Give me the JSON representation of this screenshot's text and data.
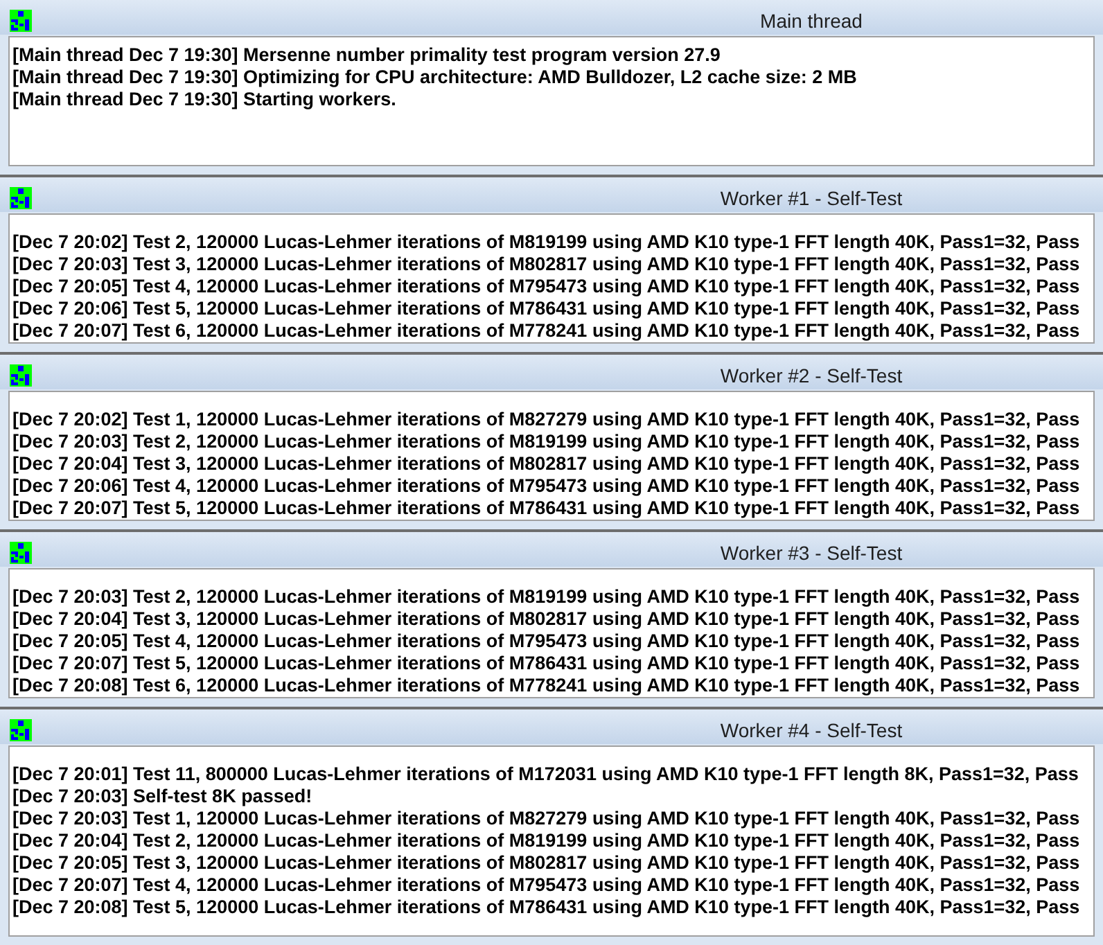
{
  "windows": [
    {
      "title": "Main thread",
      "lines": [
        "[Main thread Dec 7 19:30] Mersenne number primality test program version 27.9",
        "[Main thread Dec 7 19:30] Optimizing for CPU architecture: AMD Bulldozer, L2 cache size: 2 MB",
        "[Main thread Dec 7 19:30] Starting workers."
      ]
    },
    {
      "title": "Worker #1 - Self-Test",
      "lines": [
        "[Dec 7 20:02] Test 2, 120000 Lucas-Lehmer iterations of M819199 using AMD K10 type-1 FFT length 40K, Pass1=32, Pass",
        "[Dec 7 20:03] Test 3, 120000 Lucas-Lehmer iterations of M802817 using AMD K10 type-1 FFT length 40K, Pass1=32, Pass",
        "[Dec 7 20:05] Test 4, 120000 Lucas-Lehmer iterations of M795473 using AMD K10 type-1 FFT length 40K, Pass1=32, Pass",
        "[Dec 7 20:06] Test 5, 120000 Lucas-Lehmer iterations of M786431 using AMD K10 type-1 FFT length 40K, Pass1=32, Pass",
        "[Dec 7 20:07] Test 6, 120000 Lucas-Lehmer iterations of M778241 using AMD K10 type-1 FFT length 40K, Pass1=32, Pass"
      ]
    },
    {
      "title": "Worker #2 - Self-Test",
      "lines": [
        "[Dec 7 20:02] Test 1, 120000 Lucas-Lehmer iterations of M827279 using AMD K10 type-1 FFT length 40K, Pass1=32, Pass",
        "[Dec 7 20:03] Test 2, 120000 Lucas-Lehmer iterations of M819199 using AMD K10 type-1 FFT length 40K, Pass1=32, Pass",
        "[Dec 7 20:04] Test 3, 120000 Lucas-Lehmer iterations of M802817 using AMD K10 type-1 FFT length 40K, Pass1=32, Pass",
        "[Dec 7 20:06] Test 4, 120000 Lucas-Lehmer iterations of M795473 using AMD K10 type-1 FFT length 40K, Pass1=32, Pass",
        "[Dec 7 20:07] Test 5, 120000 Lucas-Lehmer iterations of M786431 using AMD K10 type-1 FFT length 40K, Pass1=32, Pass"
      ]
    },
    {
      "title": "Worker #3 - Self-Test",
      "lines": [
        "[Dec 7 20:03] Test 2, 120000 Lucas-Lehmer iterations of M819199 using AMD K10 type-1 FFT length 40K, Pass1=32, Pass",
        "[Dec 7 20:04] Test 3, 120000 Lucas-Lehmer iterations of M802817 using AMD K10 type-1 FFT length 40K, Pass1=32, Pass",
        "[Dec 7 20:05] Test 4, 120000 Lucas-Lehmer iterations of M795473 using AMD K10 type-1 FFT length 40K, Pass1=32, Pass",
        "[Dec 7 20:07] Test 5, 120000 Lucas-Lehmer iterations of M786431 using AMD K10 type-1 FFT length 40K, Pass1=32, Pass",
        "[Dec 7 20:08] Test 6, 120000 Lucas-Lehmer iterations of M778241 using AMD K10 type-1 FFT length 40K, Pass1=32, Pass"
      ]
    },
    {
      "title": "Worker #4 - Self-Test",
      "lines": [
        "[Dec 7 20:01] Test 11, 800000 Lucas-Lehmer iterations of M172031 using AMD K10 type-1 FFT length 8K, Pass1=32, Pass",
        "[Dec 7 20:03] Self-test 8K passed!",
        "[Dec 7 20:03] Test 1, 120000 Lucas-Lehmer iterations of M827279 using AMD K10 type-1 FFT length 40K, Pass1=32, Pass",
        "[Dec 7 20:04] Test 2, 120000 Lucas-Lehmer iterations of M819199 using AMD K10 type-1 FFT length 40K, Pass1=32, Pass",
        "[Dec 7 20:05] Test 3, 120000 Lucas-Lehmer iterations of M802817 using AMD K10 type-1 FFT length 40K, Pass1=32, Pass",
        "[Dec 7 20:07] Test 4, 120000 Lucas-Lehmer iterations of M795473 using AMD K10 type-1 FFT length 40K, Pass1=32, Pass",
        "[Dec 7 20:08] Test 5, 120000 Lucas-Lehmer iterations of M786431 using AMD K10 type-1 FFT length 40K, Pass1=32, Pass"
      ]
    }
  ]
}
